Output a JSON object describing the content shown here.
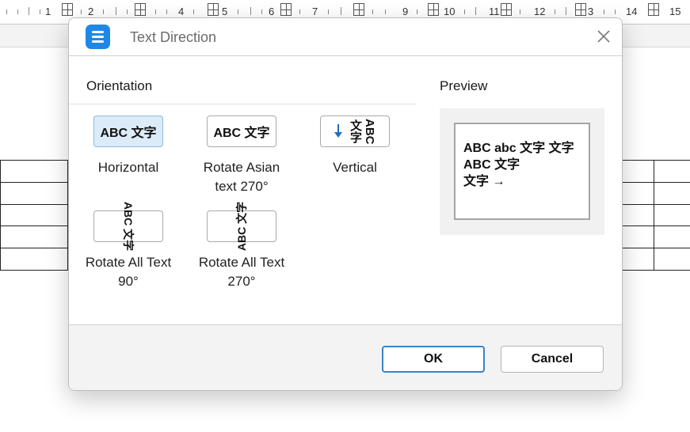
{
  "ruler": {
    "numbers": [
      "1",
      "2",
      "4",
      "5",
      "6",
      "7",
      "9",
      "10",
      "11",
      "12",
      "3",
      "14",
      "15"
    ]
  },
  "dialog": {
    "title": "Text Direction",
    "orientation_label": "Orientation",
    "preview_label": "Preview",
    "options": [
      {
        "id": "horizontal",
        "icon_text": "ABC 文字",
        "caption_lines": [
          "Horizontal"
        ],
        "selected": true
      },
      {
        "id": "rotate-asian-270",
        "icon_text": "ABC 文字",
        "caption_lines": [
          "Rotate Asian",
          "text 270°"
        ],
        "selected": false
      },
      {
        "id": "vertical",
        "icon_text": "ABC 文字",
        "caption_lines": [
          "Vertical"
        ],
        "selected": false
      },
      {
        "id": "rotate-all-90",
        "icon_text": "ABC 文字",
        "caption_lines": [
          "Rotate All Text",
          "90°"
        ],
        "selected": false
      },
      {
        "id": "rotate-all-270",
        "icon_text": "ABC 文字",
        "caption_lines": [
          "Rotate All Text",
          "270°"
        ],
        "selected": false
      }
    ],
    "preview_lines": [
      "ABC abc 文字 文字",
      "ABC 文字",
      "文字 →"
    ],
    "ok_label": "OK",
    "cancel_label": "Cancel"
  },
  "colors": {
    "accent": "#1e88e5",
    "selected_bg": "#dcebf8",
    "ok_border": "#3b82c4"
  }
}
